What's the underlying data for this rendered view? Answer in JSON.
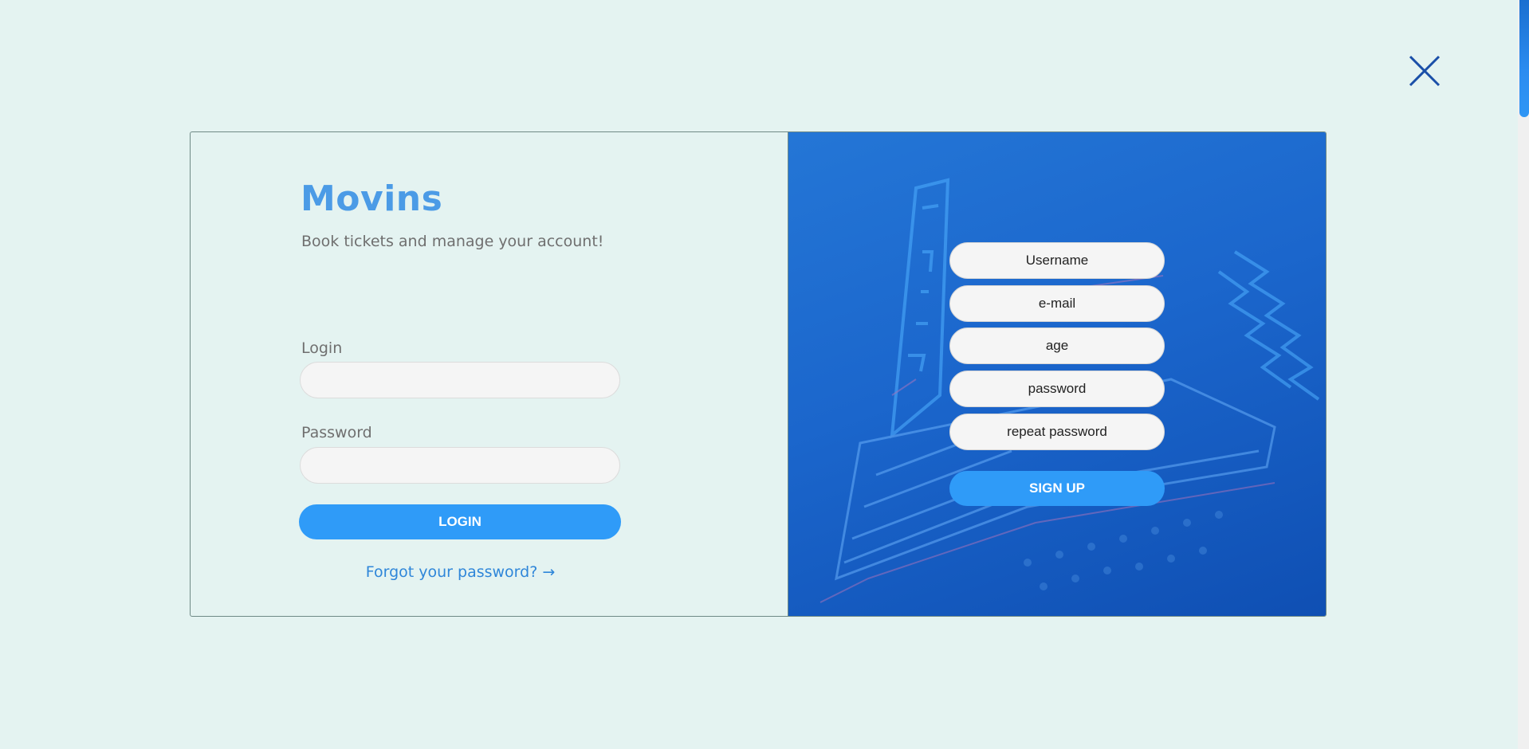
{
  "close": {
    "icon": "close-icon"
  },
  "brand": {
    "title": "Movins",
    "subtitle": "Book tickets and manage your account!"
  },
  "login_form": {
    "login_label": "Login",
    "login_value": "",
    "password_label": "Password",
    "password_value": "",
    "submit_label": "LOGIN",
    "forgot_link": "Forgot your password? →"
  },
  "signup_form": {
    "username_placeholder": "Username",
    "email_placeholder": "e-mail",
    "age_placeholder": "age",
    "password_placeholder": "password",
    "repeat_password_placeholder": "repeat password",
    "submit_label": "SIGN UP"
  },
  "colors": {
    "page_background": "#e4f3f1",
    "accent": "#2f9bf8",
    "brand": "#4b9be6",
    "link": "#2f86d9",
    "panel_gradient_start": "#2476d6",
    "panel_gradient_end": "#0f4fb3"
  }
}
